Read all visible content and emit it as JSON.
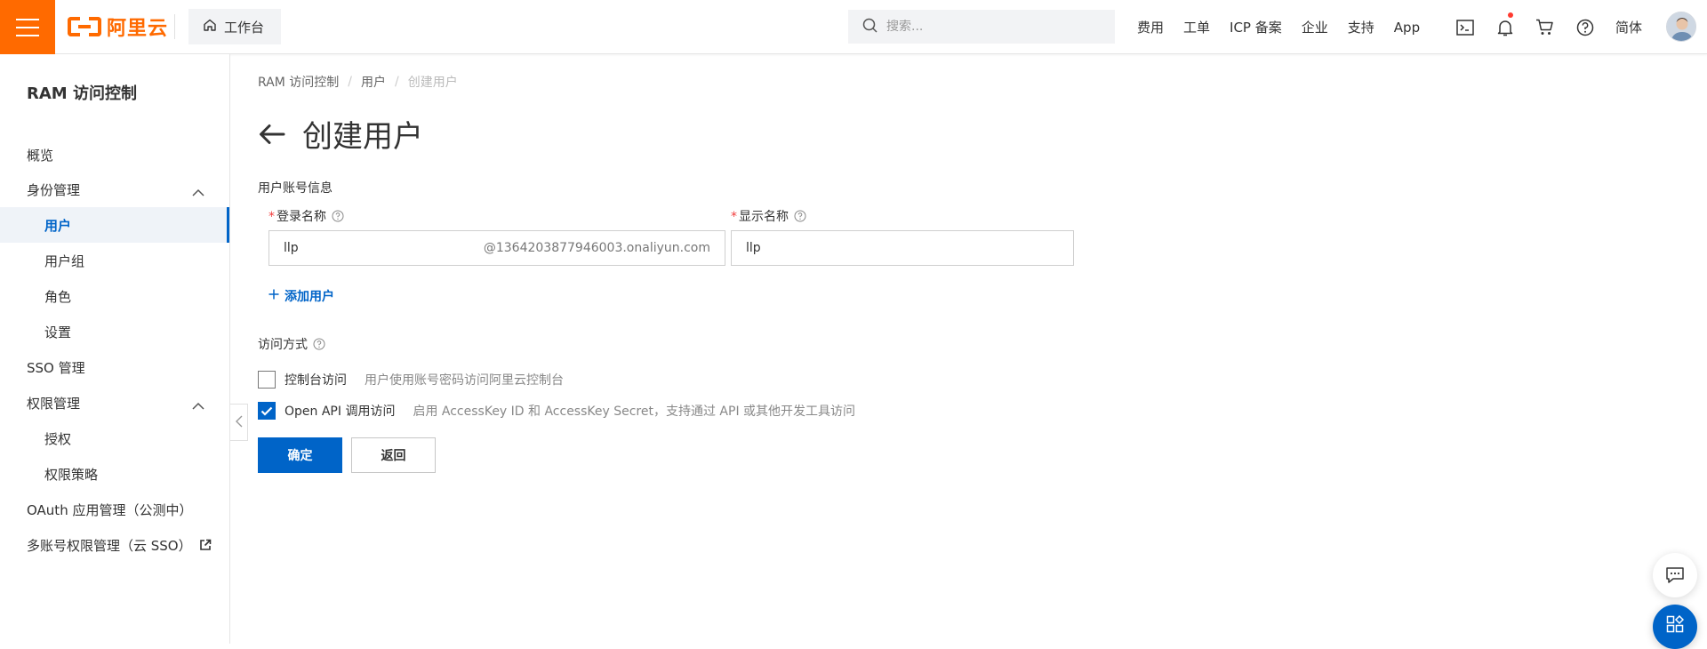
{
  "topbar": {
    "logo_text": "阿里云",
    "workbench_label": "工作台",
    "search_placeholder": "搜索...",
    "nav_links": [
      "费用",
      "工单",
      "ICP 备案",
      "企业",
      "支持",
      "App"
    ],
    "lang_label": "简体",
    "icons": [
      "terminal-icon",
      "bell-icon",
      "cart-icon",
      "help-circle-icon"
    ],
    "notification_dot_color": "#ff3b30",
    "brand_color": "#ff6a00"
  },
  "sidebar": {
    "title": "RAM 访问控制",
    "items": [
      {
        "label": "概览"
      },
      {
        "label": "身份管理"
      },
      {
        "label": "用户"
      },
      {
        "label": "用户组"
      },
      {
        "label": "角色"
      },
      {
        "label": "设置"
      },
      {
        "label": "SSO 管理"
      },
      {
        "label": "权限管理"
      },
      {
        "label": "授权"
      },
      {
        "label": "权限策略"
      },
      {
        "label": "OAuth 应用管理（公测中）"
      },
      {
        "label": "多账号权限管理（云 SSO）"
      }
    ],
    "active_item": "用户",
    "accent_color": "#0064c8"
  },
  "breadcrumb": [
    "RAM 访问控制",
    "用户",
    "创建用户"
  ],
  "page": {
    "title": "创建用户"
  },
  "form": {
    "section_account": "用户账号信息",
    "login_name_label": "登录名称",
    "login_name_value": "llp",
    "login_name_suffix": "@1364203877946003.onaliyun.com",
    "display_name_label": "显示名称",
    "display_name_value": "llp",
    "add_user_label": "添加用户",
    "section_access": "访问方式",
    "access_options": [
      {
        "label": "控制台访问",
        "desc": "用户使用账号密码访问阿里云控制台",
        "checked": false
      },
      {
        "label": "Open API 调用访问",
        "desc": "启用 AccessKey ID 和 AccessKey Secret，支持通过 API 或其他开发工具访问",
        "checked": true
      }
    ],
    "confirm_label": "确定",
    "back_label": "返回"
  }
}
